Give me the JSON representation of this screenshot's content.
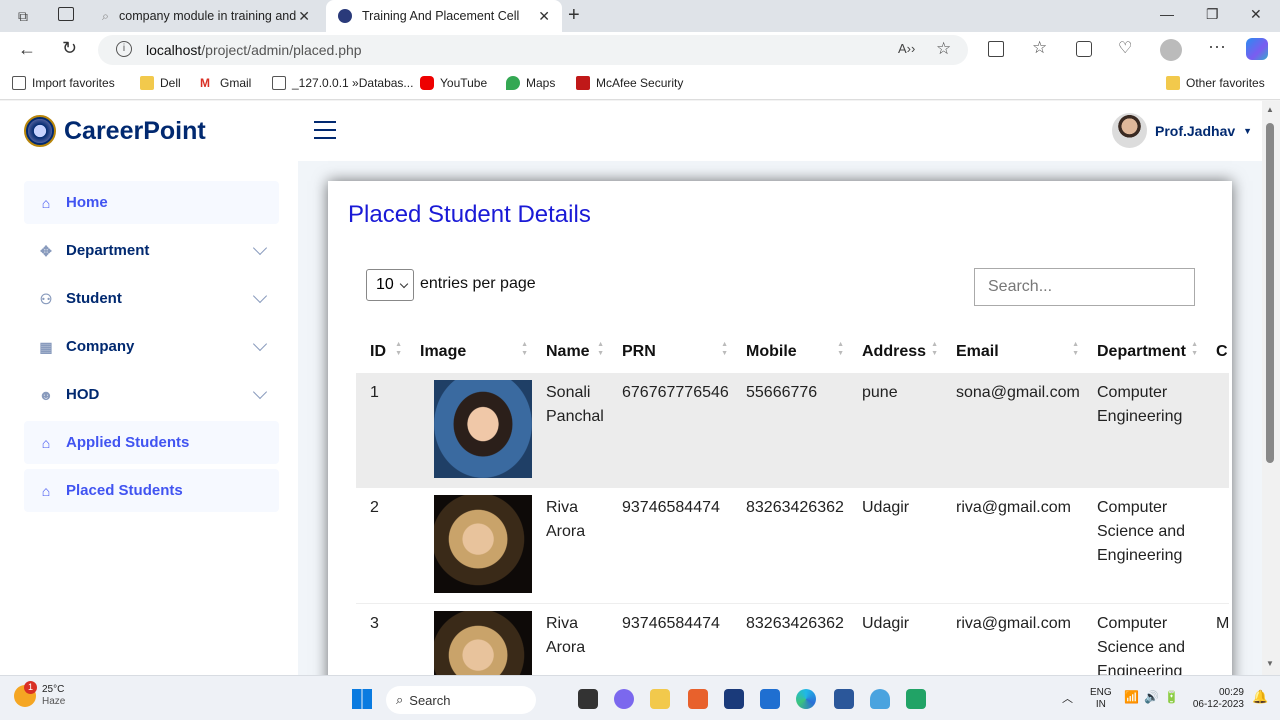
{
  "browser": {
    "tab_inactive": "company module in training and",
    "tab_active": "Training And Placement Cell",
    "url_host": "localhost",
    "url_path": "/project/admin/placed.php",
    "favorites": [
      "Import favorites",
      "Dell",
      "Gmail",
      "_127.0.0.1 »Databas...",
      "YouTube",
      "Maps",
      "McAfee Security"
    ],
    "other_favorites": "Other favorites"
  },
  "header": {
    "brand": "CareerPoint",
    "user": "Prof.Jadhav"
  },
  "sidebar": {
    "items": [
      {
        "label": "Home",
        "icon": "home-icon",
        "style": "filled",
        "expandable": false
      },
      {
        "label": "Department",
        "icon": "grid-icon",
        "style": "plain",
        "expandable": true
      },
      {
        "label": "Student",
        "icon": "people-icon",
        "style": "plain",
        "expandable": true
      },
      {
        "label": "Company",
        "icon": "layout-icon",
        "style": "plain",
        "expandable": true
      },
      {
        "label": "HOD",
        "icon": "person-icon",
        "style": "plain",
        "expandable": true
      },
      {
        "label": "Applied Students",
        "icon": "bank-icon",
        "style": "filled",
        "expandable": false
      },
      {
        "label": "Placed Students",
        "icon": "bank-icon",
        "style": "filled",
        "expandable": false
      }
    ]
  },
  "main": {
    "title": "Placed Student Details",
    "entries_value": "10",
    "entries_label": "entries per page",
    "search_placeholder": "Search...",
    "columns": [
      "ID",
      "Image",
      "Name",
      "PRN",
      "Mobile",
      "Address",
      "Email",
      "Department",
      "C"
    ],
    "rows": [
      {
        "id": "1",
        "name": "Sonali Panchal",
        "prn": "676767776546",
        "mobile": "55666776",
        "address": "pune",
        "email": "sona@gmail.com",
        "department": "Computer Engineering",
        "extra": ""
      },
      {
        "id": "2",
        "name": "Riva Arora",
        "prn": "93746584474",
        "mobile": "83263426362",
        "address": "Udagir",
        "email": "riva@gmail.com",
        "department": "Computer Science and Engineering",
        "extra": ""
      },
      {
        "id": "3",
        "name": "Riva Arora",
        "prn": "93746584474",
        "mobile": "83263426362",
        "address": "Udagir",
        "email": "riva@gmail.com",
        "department": "Computer Science and Engineering",
        "extra": "M"
      }
    ]
  },
  "taskbar": {
    "weather_temp": "25°C",
    "weather_desc": "Haze",
    "weather_badge": "1",
    "search": "Search",
    "lang": "ENG",
    "region": "IN",
    "time": "00:29",
    "date": "06-12-2023"
  }
}
